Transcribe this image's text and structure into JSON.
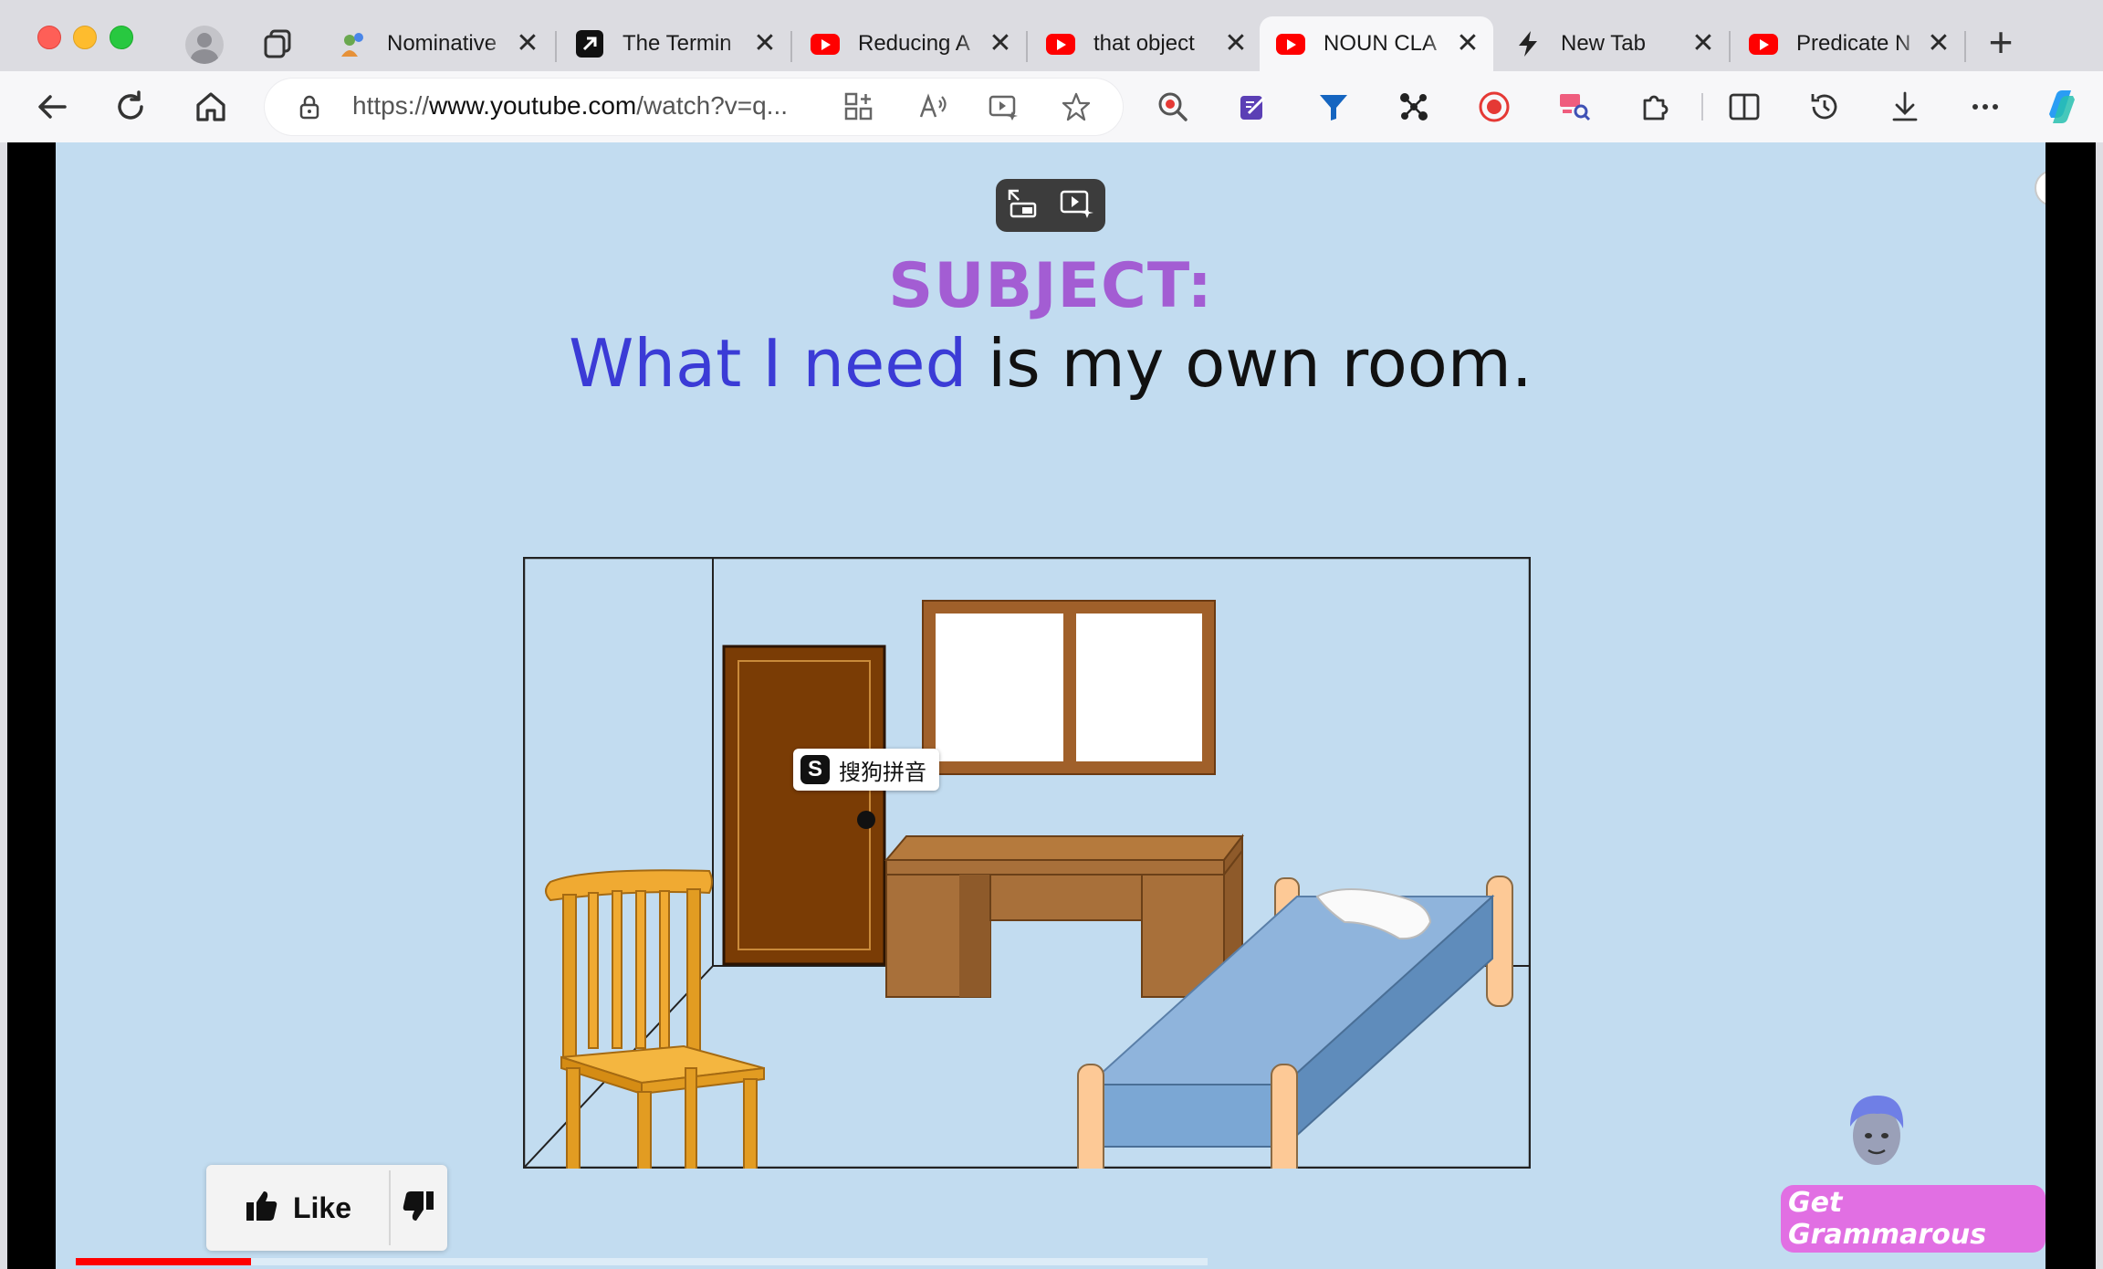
{
  "browser": {
    "tabs": [
      {
        "title": "Nominative",
        "favicon": "people-icon",
        "active": false
      },
      {
        "title": "The Termin",
        "favicon": "arrow-icon",
        "active": false
      },
      {
        "title": "Reducing A",
        "favicon": "youtube-icon",
        "active": false
      },
      {
        "title": "that object",
        "favicon": "youtube-icon",
        "active": false
      },
      {
        "title": "NOUN CLA",
        "favicon": "youtube-icon",
        "active": true
      },
      {
        "title": "New Tab",
        "favicon": "bolt-icon",
        "active": false
      },
      {
        "title": "Predicate N",
        "favicon": "youtube-icon",
        "active": false
      }
    ],
    "close_glyph": "✕",
    "new_tab_glyph": "+",
    "url_prefix": "https://",
    "url_domain": "www.youtube.com",
    "url_path": "/watch?v=q..."
  },
  "video": {
    "heading": "SUBJECT:",
    "sentence_subject": "What I need",
    "sentence_rest": " is my own room.",
    "ime_label": "搜狗拼音",
    "ime_logo": "S",
    "info_glyph": "i",
    "like_label": "Like",
    "channel_brand": "Get Grammarous",
    "progress_fraction": 0.155,
    "colors": {
      "subject_label": "#a35dd3",
      "subject_phrase": "#3b3bd6",
      "background": "#c2dcf0",
      "progress": "#ff0000"
    }
  }
}
